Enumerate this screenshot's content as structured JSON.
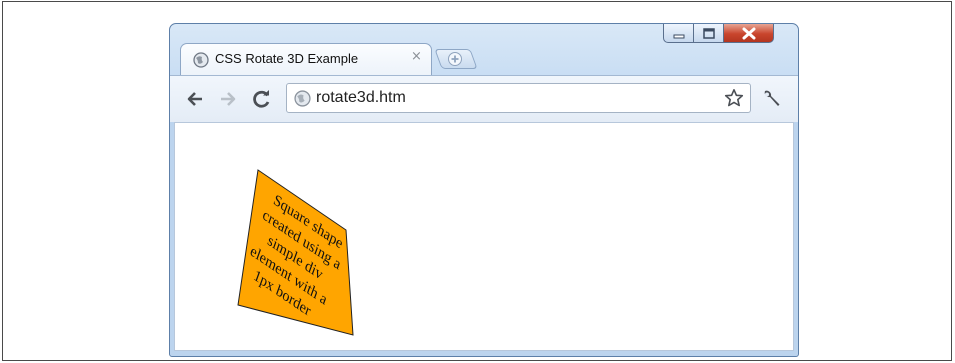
{
  "browser": {
    "tab_title": "CSS Rotate 3D Example",
    "tab_close": "×",
    "address_url": "rotate3d.htm"
  },
  "content": {
    "card_text": "Square shape created using a simple div element with a 1px border",
    "card_color": "#ffa500"
  },
  "colors": {
    "window_frame": "#c6dcf3",
    "close_button": "#c9452d"
  },
  "icons": {
    "favicon": "globe-icon",
    "new_tab": "plus-icon",
    "back": "arrow-left-icon",
    "forward": "arrow-right-icon",
    "reload": "reload-icon",
    "bookmark": "star-icon",
    "menu": "wrench-icon",
    "minimize": "minimize-icon",
    "maximize": "maximize-icon",
    "close": "close-icon"
  }
}
